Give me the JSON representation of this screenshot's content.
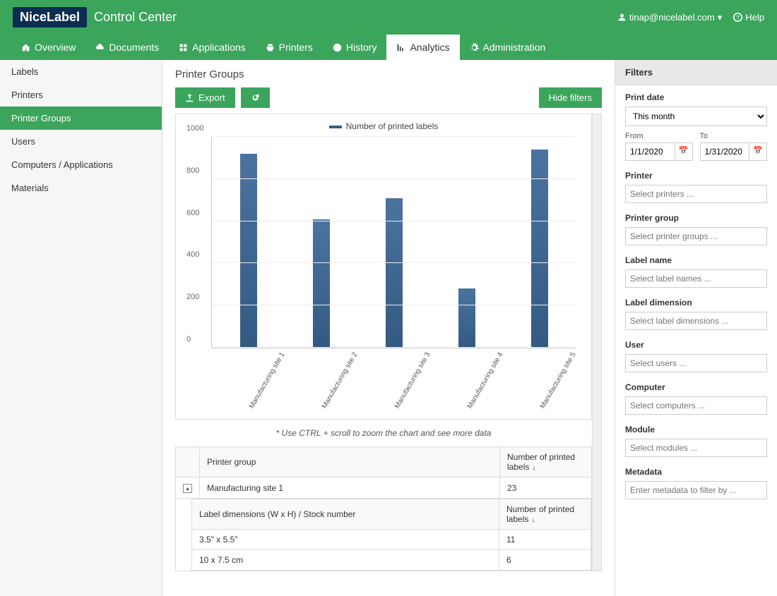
{
  "header": {
    "logo": "NiceLabel",
    "title": "Control Center",
    "user": "tinap@nicelabel.com",
    "help": "Help"
  },
  "nav": [
    {
      "label": "Overview",
      "icon": "home"
    },
    {
      "label": "Documents",
      "icon": "cloud"
    },
    {
      "label": "Applications",
      "icon": "grid"
    },
    {
      "label": "Printers",
      "icon": "printer"
    },
    {
      "label": "History",
      "icon": "clock"
    },
    {
      "label": "Analytics",
      "icon": "chart",
      "active": true
    },
    {
      "label": "Administration",
      "icon": "gear"
    }
  ],
  "sidebar": [
    {
      "label": "Labels"
    },
    {
      "label": "Printers"
    },
    {
      "label": "Printer Groups",
      "active": true
    },
    {
      "label": "Users"
    },
    {
      "label": "Computers / Applications"
    },
    {
      "label": "Materials"
    }
  ],
  "page_title": "Printer Groups",
  "toolbar": {
    "export": "Export",
    "hide_filters": "Hide filters"
  },
  "chart_data": {
    "type": "bar",
    "title": "Number of printed labels",
    "categories": [
      "Manufacturing site 1",
      "Manufacturing site 2",
      "Manufacturing site 3",
      "Manufacturing site 4",
      "Manufacturing site 5"
    ],
    "values": [
      920,
      610,
      710,
      280,
      940
    ],
    "ylim": [
      0,
      1000
    ],
    "yticks": [
      0,
      200,
      400,
      600,
      800,
      1000
    ]
  },
  "chart_hint": "* Use CTRL + scroll to zoom the chart and see more data",
  "table": {
    "columns": [
      "Printer group",
      "Number of printed labels"
    ],
    "row": {
      "group": "Manufacturing site 1",
      "count": "23"
    },
    "nested_columns": [
      "Label dimensions (W x H) / Stock number",
      "Number of printed labels"
    ],
    "nested_rows": [
      {
        "dim": "3.5\" x 5.5\"",
        "count": "11"
      },
      {
        "dim": "10 x 7.5 cm",
        "count": "6"
      }
    ]
  },
  "filters": {
    "header": "Filters",
    "print_date": {
      "label": "Print date",
      "select": "This month",
      "from_label": "From",
      "to_label": "To",
      "from": "1/1/2020",
      "to": "1/31/2020"
    },
    "printer": {
      "label": "Printer",
      "placeholder": "Select printers ..."
    },
    "printer_group": {
      "label": "Printer group",
      "placeholder": "Select printer groups ..."
    },
    "label_name": {
      "label": "Label name",
      "placeholder": "Select label names ..."
    },
    "label_dimension": {
      "label": "Label dimension",
      "placeholder": "Select label dimensions ..."
    },
    "user": {
      "label": "User",
      "placeholder": "Select users ..."
    },
    "computer": {
      "label": "Computer",
      "placeholder": "Select computers ..."
    },
    "module": {
      "label": "Module",
      "placeholder": "Select modules ..."
    },
    "metadata": {
      "label": "Metadata",
      "placeholder": "Enter metadata to filter by ..."
    }
  }
}
